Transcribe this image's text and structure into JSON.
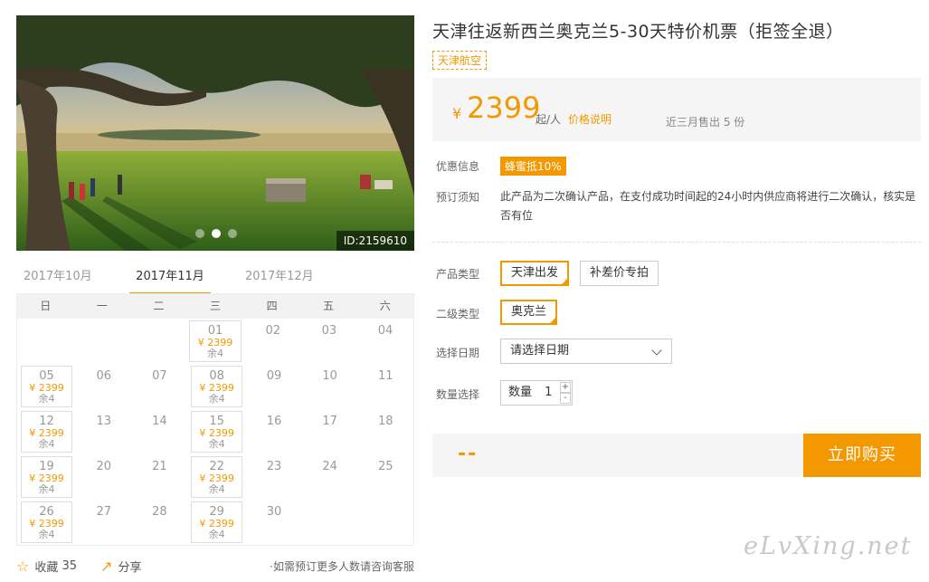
{
  "hero": {
    "image_id": "ID:2159610",
    "slide_count": 3,
    "active_slide": 2
  },
  "calendar": {
    "months": [
      "2017年10月",
      "2017年11月",
      "2017年12月"
    ],
    "active_month_index": 1,
    "weekdays": [
      "日",
      "一",
      "二",
      "三",
      "四",
      "五",
      "六"
    ],
    "weeks": [
      [
        null,
        null,
        null,
        {
          "day": "01",
          "price": "¥ 2399",
          "remain": "余4"
        },
        {
          "day": "02"
        },
        {
          "day": "03"
        },
        {
          "day": "04"
        }
      ],
      [
        {
          "day": "05",
          "price": "¥ 2399",
          "remain": "余4"
        },
        {
          "day": "06"
        },
        {
          "day": "07"
        },
        {
          "day": "08",
          "price": "¥ 2399",
          "remain": "余4"
        },
        {
          "day": "09"
        },
        {
          "day": "10"
        },
        {
          "day": "11"
        }
      ],
      [
        {
          "day": "12",
          "price": "¥ 2399",
          "remain": "余4"
        },
        {
          "day": "13"
        },
        {
          "day": "14"
        },
        {
          "day": "15",
          "price": "¥ 2399",
          "remain": "余4"
        },
        {
          "day": "16"
        },
        {
          "day": "17"
        },
        {
          "day": "18"
        }
      ],
      [
        {
          "day": "19",
          "price": "¥ 2399",
          "remain": "余4"
        },
        {
          "day": "20"
        },
        {
          "day": "21"
        },
        {
          "day": "22",
          "price": "¥ 2399",
          "remain": "余4"
        },
        {
          "day": "23"
        },
        {
          "day": "24"
        },
        {
          "day": "25"
        }
      ],
      [
        {
          "day": "26",
          "price": "¥ 2399",
          "remain": "余4"
        },
        {
          "day": "27"
        },
        {
          "day": "28"
        },
        {
          "day": "29",
          "price": "¥ 2399",
          "remain": "余4"
        },
        {
          "day": "30"
        },
        null,
        null
      ]
    ]
  },
  "actions": {
    "favorite_label": "收藏",
    "favorite_count": "35",
    "share_label": "分享",
    "note": "如需预订更多人数请咨询客服"
  },
  "product": {
    "title": "天津往返新西兰奥克兰5-30天特价机票（拒签全退）",
    "airline": "天津航空",
    "currency": "¥",
    "price": "2399",
    "price_unit": "起/人",
    "price_explain": "价格说明",
    "sold_text": "近三月售出 5 份"
  },
  "info": {
    "promo_label": "优惠信息",
    "promo_badge": "蜂蜜抵10%",
    "notice_label": "预订须知",
    "notice_text": "此产品为二次确认产品，在支付成功时间起的24小时内供应商将进行二次确认，核实是否有位"
  },
  "options": {
    "type_label": "产品类型",
    "type_options": [
      "天津出发",
      "补差价专拍"
    ],
    "subtype_label": "二级类型",
    "subtype_options": [
      "奥克兰"
    ],
    "date_label": "选择日期",
    "date_placeholder": "请选择日期",
    "qty_label": "数量选择",
    "qty_field_label": "数量",
    "qty_value": "1",
    "plus": "+",
    "minus": "-"
  },
  "buy": {
    "total_placeholder": "--",
    "button_label": "立即购买"
  },
  "watermark": "eLvXing.net",
  "colors": {
    "accent": "#f39800",
    "panel_bg": "#f5f5f5"
  }
}
